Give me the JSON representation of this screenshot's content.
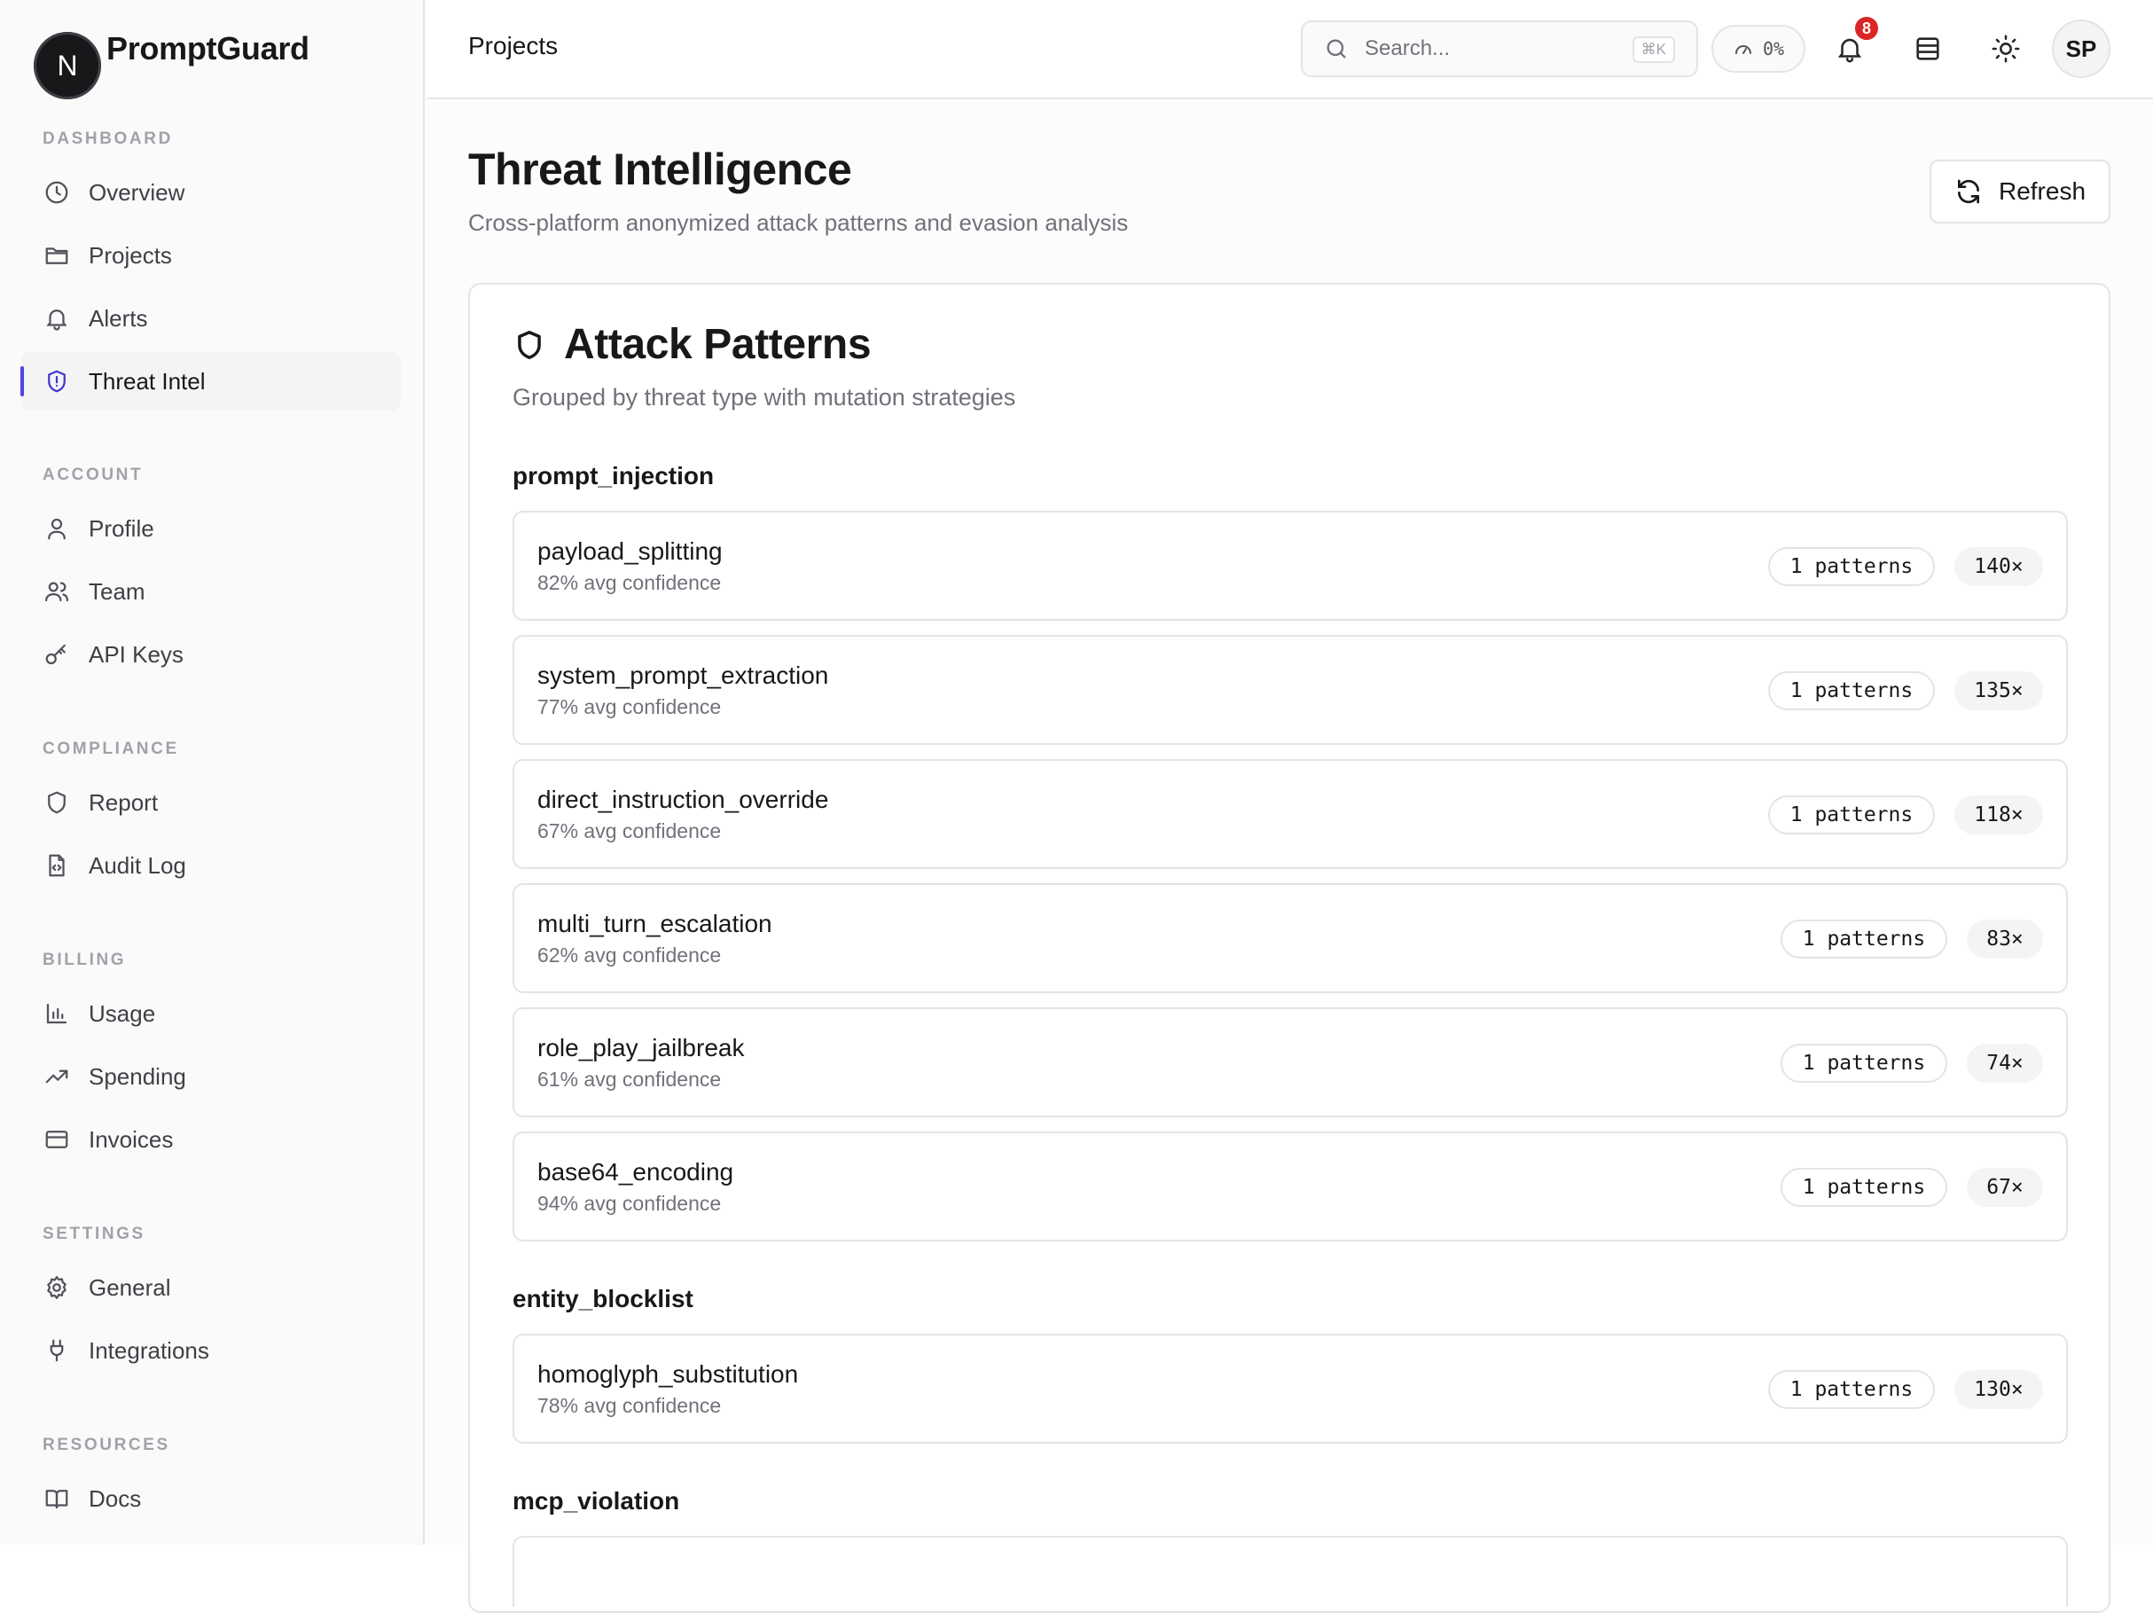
{
  "brand": {
    "logo_letter": "N",
    "name": "PromptGuard"
  },
  "sidebar": {
    "sections": [
      {
        "heading": "DASHBOARD",
        "items": [
          {
            "label": "Overview",
            "icon": "clock-icon"
          },
          {
            "label": "Projects",
            "icon": "folder-icon"
          },
          {
            "label": "Alerts",
            "icon": "bell-icon"
          },
          {
            "label": "Threat Intel",
            "icon": "shield-alert-icon",
            "active": true
          }
        ]
      },
      {
        "heading": "ACCOUNT",
        "items": [
          {
            "label": "Profile",
            "icon": "user-icon"
          },
          {
            "label": "Team",
            "icon": "users-icon"
          },
          {
            "label": "API Keys",
            "icon": "key-icon"
          }
        ]
      },
      {
        "heading": "COMPLIANCE",
        "items": [
          {
            "label": "Report",
            "icon": "shield-icon"
          },
          {
            "label": "Audit Log",
            "icon": "file-code-icon"
          }
        ]
      },
      {
        "heading": "BILLING",
        "items": [
          {
            "label": "Usage",
            "icon": "bar-chart-icon"
          },
          {
            "label": "Spending",
            "icon": "trending-up-icon"
          },
          {
            "label": "Invoices",
            "icon": "credit-card-icon"
          }
        ]
      },
      {
        "heading": "SETTINGS",
        "items": [
          {
            "label": "General",
            "icon": "gear-icon"
          },
          {
            "label": "Integrations",
            "icon": "plug-icon"
          }
        ]
      },
      {
        "heading": "RESOURCES",
        "items": [
          {
            "label": "Docs",
            "icon": "book-icon"
          }
        ]
      }
    ]
  },
  "header": {
    "title": "Projects",
    "search_placeholder": "Search...",
    "search_shortcut": "⌘K",
    "usage_percent": "0%",
    "notification_count": "8",
    "avatar_initials": "SP"
  },
  "page": {
    "title": "Threat Intelligence",
    "subtitle": "Cross-platform anonymized attack patterns and evasion analysis",
    "refresh_label": "Refresh"
  },
  "card": {
    "title": "Attack Patterns",
    "description": "Grouped by threat type with mutation strategies",
    "groups": [
      {
        "name": "prompt_injection",
        "items": [
          {
            "name": "payload_splitting",
            "confidence": "82% avg confidence",
            "patterns": "1 patterns",
            "count": "140×"
          },
          {
            "name": "system_prompt_extraction",
            "confidence": "77% avg confidence",
            "patterns": "1 patterns",
            "count": "135×"
          },
          {
            "name": "direct_instruction_override",
            "confidence": "67% avg confidence",
            "patterns": "1 patterns",
            "count": "118×"
          },
          {
            "name": "multi_turn_escalation",
            "confidence": "62% avg confidence",
            "patterns": "1 patterns",
            "count": "83×"
          },
          {
            "name": "role_play_jailbreak",
            "confidence": "61% avg confidence",
            "patterns": "1 patterns",
            "count": "74×"
          },
          {
            "name": "base64_encoding",
            "confidence": "94% avg confidence",
            "patterns": "1 patterns",
            "count": "67×"
          }
        ]
      },
      {
        "name": "entity_blocklist",
        "items": [
          {
            "name": "homoglyph_substitution",
            "confidence": "78% avg confidence",
            "patterns": "1 patterns",
            "count": "130×"
          }
        ]
      },
      {
        "name": "mcp_violation",
        "items": []
      }
    ]
  },
  "colors": {
    "accent": "#4f46e5",
    "badge": "#dc2626",
    "border": "#e4e4e7",
    "muted": "#71717a"
  }
}
